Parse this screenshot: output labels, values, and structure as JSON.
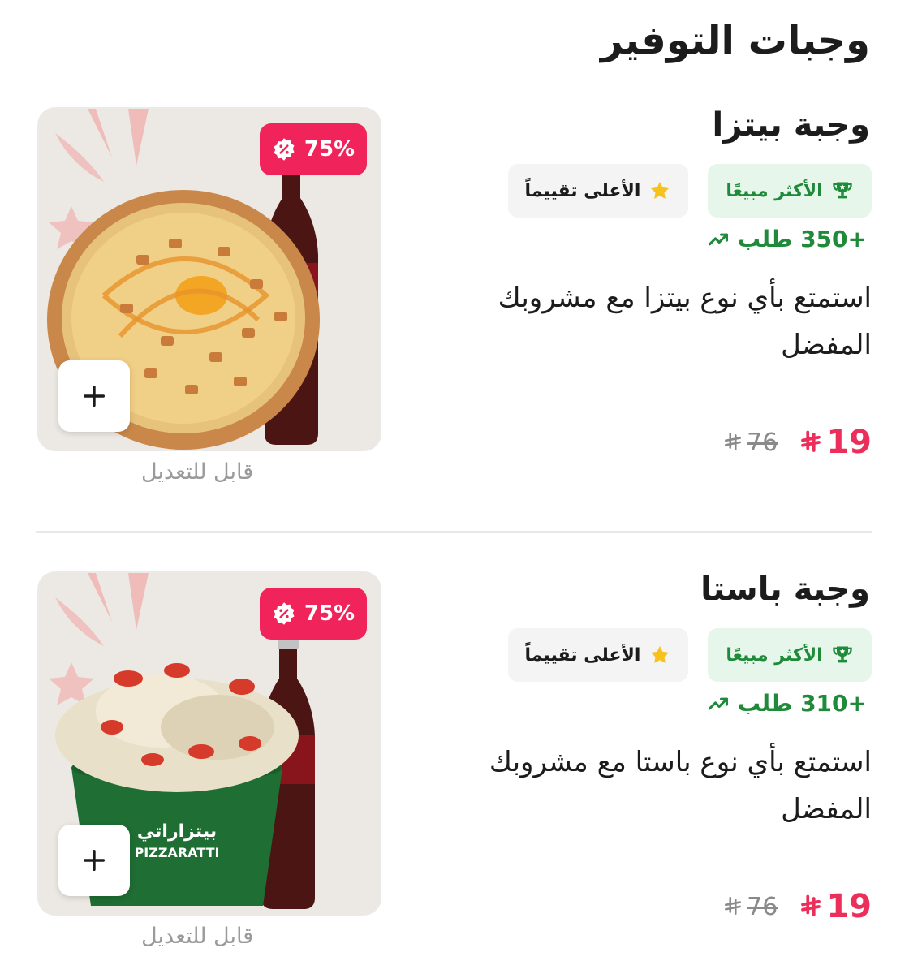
{
  "section": {
    "title": "وجبات التوفير"
  },
  "colors": {
    "accent": "#ec2e5a",
    "success": "#1e8a3a",
    "success_bg": "#e6f6ea",
    "star": "#f7c21c"
  },
  "meals": [
    {
      "title": "وجبة بيتزا",
      "badges": {
        "best_seller": "الأكثر مبيعًا",
        "top_rated": "الأعلى تقييماً"
      },
      "orders": "+350 طلب",
      "description": "استمتع بأي نوع بيتزا مع مشروبك المفضل",
      "price_new": "19",
      "price_old": "76",
      "discount": "75%",
      "editable": "قابل للتعديل",
      "image": "pizza-with-cola"
    },
    {
      "title": "وجبة باستا",
      "badges": {
        "best_seller": "الأكثر مبيعًا",
        "top_rated": "الأعلى تقييماً"
      },
      "orders": "+310 طلب",
      "description": "استمتع بأي نوع باستا مع مشروبك المفضل",
      "price_new": "19",
      "price_old": "76",
      "discount": "75%",
      "editable": "قابل للتعديل",
      "image": "pasta-bowl-with-cola",
      "bowl_brand_ar": "بيتزاراتي",
      "bowl_brand_en": "PIZZARATTI"
    }
  ],
  "icons": {
    "trophy": "trophy-icon",
    "star": "star-icon",
    "trend": "trending-up-icon",
    "riyal": "riyal-currency-icon",
    "discount": "discount-badge-icon",
    "add": "plus-icon"
  }
}
